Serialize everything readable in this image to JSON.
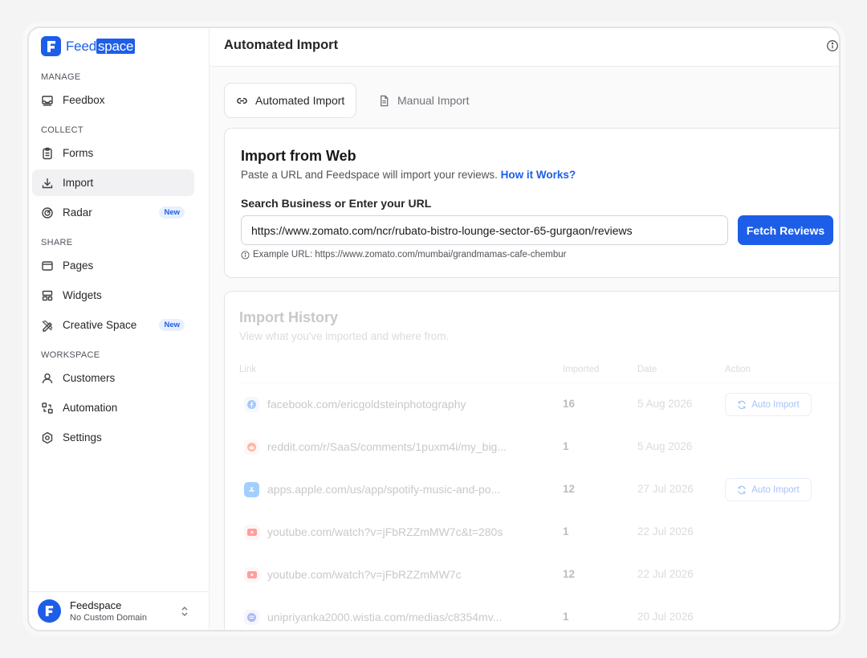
{
  "brand": {
    "name_prefix": "Feed",
    "name_highlight": "space",
    "color": "#1d5ee8"
  },
  "sidebar": {
    "sections": [
      "MANAGE",
      "COLLECT",
      "SHARE",
      "WORKSPACE"
    ],
    "items": [
      {
        "label": "Feedbox",
        "icon": "inbox-icon"
      },
      {
        "label": "Forms",
        "icon": "clipboard-icon"
      },
      {
        "label": "Import",
        "icon": "download-icon",
        "active": true
      },
      {
        "label": "Radar",
        "icon": "radar-icon",
        "badge": "New"
      },
      {
        "label": "Pages",
        "icon": "browser-icon"
      },
      {
        "label": "Widgets",
        "icon": "layout-icon"
      },
      {
        "label": "Creative Space",
        "icon": "pencil-ruler-icon",
        "badge": "New"
      },
      {
        "label": "Customers",
        "icon": "user-icon"
      },
      {
        "label": "Automation",
        "icon": "workflow-icon"
      },
      {
        "label": "Settings",
        "icon": "gear-icon"
      }
    ],
    "account": {
      "name": "Feedspace",
      "subtitle": "No Custom Domain"
    }
  },
  "header": {
    "title": "Automated Import"
  },
  "tabs": [
    {
      "label": "Automated Import",
      "icon": "link-icon",
      "active": true
    },
    {
      "label": "Manual Import",
      "icon": "document-icon",
      "active": false
    }
  ],
  "import_card": {
    "title": "Import from Web",
    "subtitle": "Paste a URL and Feedspace will import your reviews.",
    "how_link": "How it Works?",
    "field_label": "Search Business or Enter your URL",
    "url_value": "https://www.zomato.com/ncr/rubato-bistro-lounge-sector-65-gurgaon/reviews",
    "button": "Fetch Reviews",
    "example": "Example URL: https://www.zomato.com/mumbai/grandmamas-cafe-chembur"
  },
  "history": {
    "title": "Import History",
    "subtitle": "View what you've imported and where from.",
    "columns": [
      "Link",
      "Imported",
      "Date",
      "Action"
    ],
    "action_label": "Auto Import",
    "rows": [
      {
        "icon": "facebook-icon",
        "icon_color": "#1877f2",
        "link": "facebook.com/ericgoldsteinphotography",
        "count": "16",
        "date": "5 Aug 2026",
        "action": true
      },
      {
        "icon": "reddit-icon",
        "icon_color": "#ff4500",
        "link": "reddit.com/r/SaaS/comments/1puxm4i/my_big...",
        "count": "1",
        "date": "5 Aug 2026",
        "action": false
      },
      {
        "icon": "app-store-icon",
        "icon_color": "#0d84ff",
        "link": "apps.apple.com/us/app/spotify-music-and-po...",
        "count": "12",
        "date": "27 Jul 2026",
        "action": true
      },
      {
        "icon": "youtube-icon",
        "icon_color": "#ff0000",
        "link": "youtube.com/watch?v=jFbRZZmMW7c&t=280s",
        "count": "1",
        "date": "22 Jul 2026",
        "action": false
      },
      {
        "icon": "youtube-icon",
        "icon_color": "#ff0000",
        "link": "youtube.com/watch?v=jFbRZZmMW7c",
        "count": "12",
        "date": "22 Jul 2026",
        "action": false
      },
      {
        "icon": "wistia-icon",
        "icon_color": "#2949e5",
        "link": "unipriyanka2000.wistia.com/medias/c8354mv...",
        "count": "1",
        "date": "20 Jul 2026",
        "action": false
      }
    ]
  }
}
